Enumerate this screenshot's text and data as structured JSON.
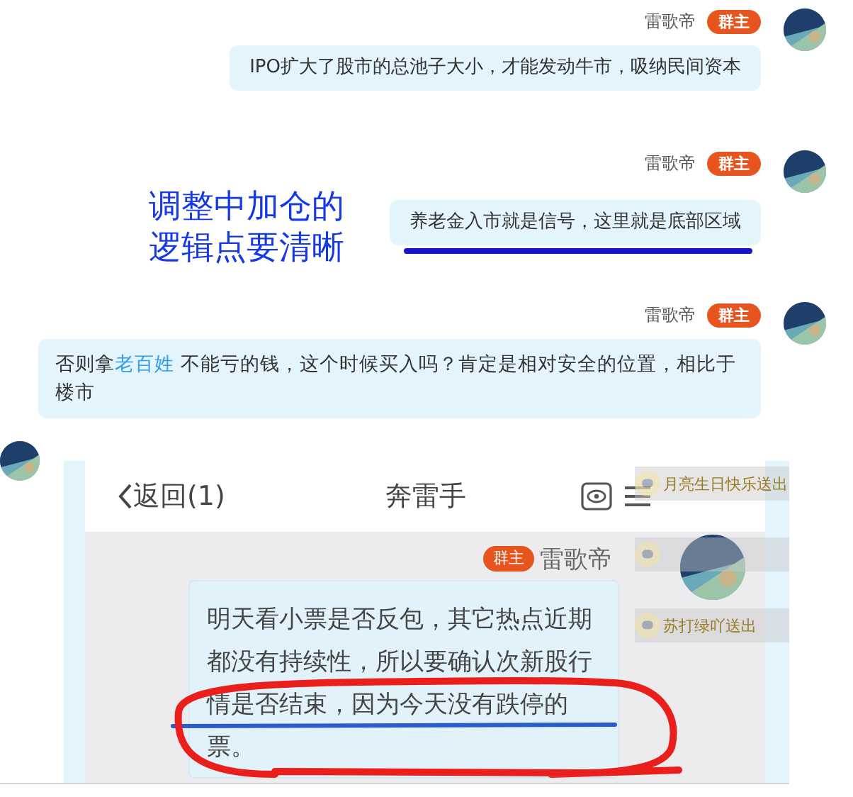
{
  "messages": [
    {
      "sender": "雷歌帝",
      "badge": "群主",
      "segments": [
        {
          "kind": "plain",
          "text": "IPO扩大了股市的总池子大小，才能发动牛市，吸纳民间资本"
        }
      ]
    },
    {
      "sender": "雷歌帝",
      "badge": "群主",
      "annotation": "调整中加仓的逻辑点要清晰",
      "underlined": true,
      "segments": [
        {
          "kind": "plain",
          "text": "养老金入市就是信号，这里就是底部区域"
        }
      ]
    },
    {
      "sender": "雷歌帝",
      "badge": "群主",
      "segments": [
        {
          "kind": "plain",
          "text": "否则拿"
        },
        {
          "kind": "link",
          "text": "老百姓"
        },
        {
          "kind": "plain",
          "text": " 不能亏的钱，这个时候买入吗？肯定是相对安全的位置，相比于楼市"
        }
      ]
    }
  ],
  "embedded_screenshot": {
    "back_label": "返回(1)",
    "title": "奔雷手",
    "gift_notices": [
      {
        "kind": "text",
        "text": "月亮生日快乐送出"
      },
      {
        "kind": "blank"
      },
      {
        "kind": "text",
        "text": "苏打绿吖送出"
      }
    ],
    "message": {
      "badge": "群主",
      "sender": "雷歌帝",
      "text": "明天看小票是否反包，其它热点近期都没有持续性，所以要确认次新股行情是否结束，因为今天没有跌停的票。"
    }
  }
}
